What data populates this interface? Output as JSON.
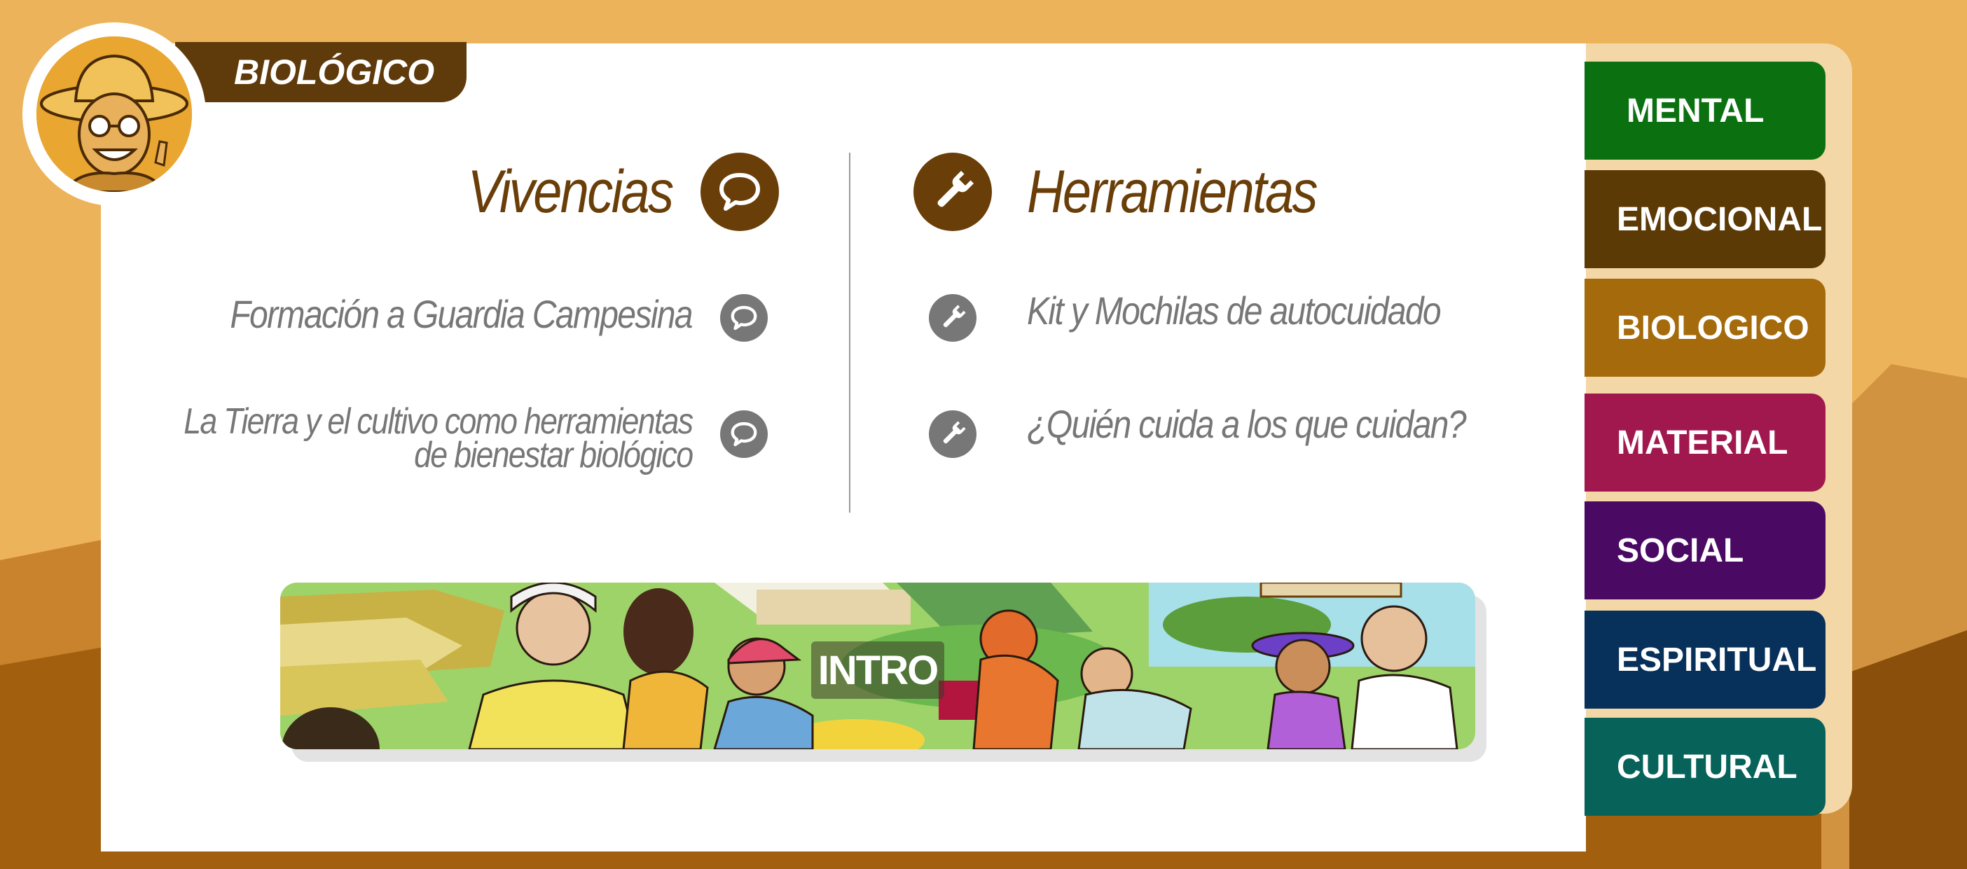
{
  "header": {
    "section_tag": "BIOLÓGICO",
    "avatar_icon": "farmer-avatar-icon"
  },
  "vivencias": {
    "title": "Vivencias",
    "icon": "speech-bubble-icon",
    "items": [
      {
        "lines": [
          "Formación a Guardia Campesina"
        ]
      },
      {
        "lines": [
          "La Tierra y el cultivo como herramientas",
          "de bienestar biológico"
        ]
      }
    ]
  },
  "herramientas": {
    "title": "Herramientas",
    "icon": "wrench-icon",
    "items": [
      {
        "lines": [
          "Kit y Mochilas de autocuidado"
        ]
      },
      {
        "lines": [
          "¿Quién cuida a los que cuidan?"
        ]
      }
    ]
  },
  "banner": {
    "label": "INTRO"
  },
  "nav": [
    {
      "label": "MENTAL",
      "color": "#0B7110"
    },
    {
      "label": "EMOCIONAL",
      "color": "#5C3A06"
    },
    {
      "label": "BIOLOGICO",
      "color": "#A46A0B"
    },
    {
      "label": "MATERIAL",
      "color": "#A1184F"
    },
    {
      "label": "SOCIAL",
      "color": "#4A0A63"
    },
    {
      "label": "ESPIRITUAL",
      "color": "#07305A"
    },
    {
      "label": "CULTURAL",
      "color": "#07625A"
    }
  ],
  "colors": {
    "brand_brown": "#6A3E08",
    "background": "#EDB35A",
    "item_grey": "#777777"
  }
}
